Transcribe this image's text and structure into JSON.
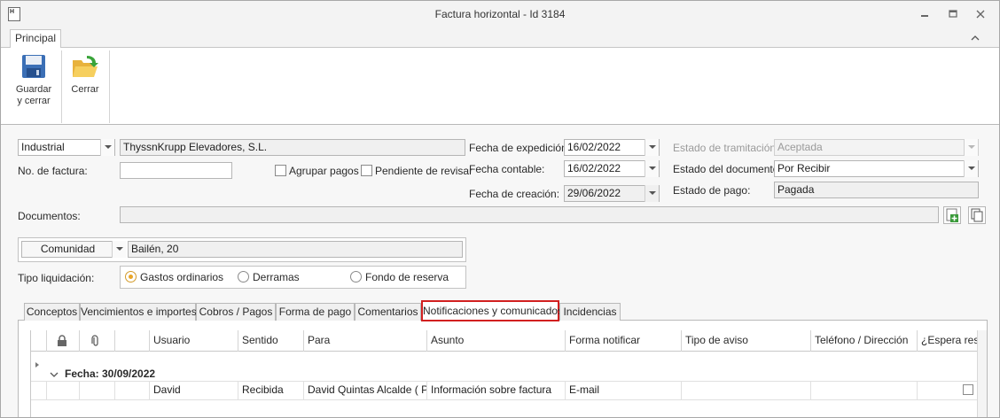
{
  "window": {
    "title": "Factura horizontal - Id 3184",
    "app_icon_text": "H"
  },
  "ribbon": {
    "tab_principal": "Principal",
    "save_label_1": "Guardar",
    "save_label_2": "y cerrar",
    "close_label": "Cerrar"
  },
  "form": {
    "tipo_value": "Industrial",
    "proveedor_value": "ThyssnKrupp Elevadores, S.L.",
    "factura_label": "No. de factura:",
    "factura_value": "",
    "agrupar_label": "Agrupar pagos",
    "pendiente_label": "Pendiente de revisar",
    "fecha_expedicion_label": "Fecha de expedición:",
    "fecha_expedicion_value": "16/02/2022",
    "fecha_contable_label": "Fecha contable:",
    "fecha_contable_value": "16/02/2022",
    "fecha_creacion_label": "Fecha de creación:",
    "fecha_creacion_value": "29/06/2022",
    "estado_tramitacion_label": "Estado de tramitación:",
    "estado_tramitacion_value": "Aceptada",
    "estado_documento_label": "Estado del documento:",
    "estado_documento_value": "Por Recibir",
    "estado_pago_label": "Estado de pago:",
    "estado_pago_value": "Pagada",
    "documentos_label": "Documentos:",
    "comunidad_type": "Comunidad",
    "comunidad_value": "Bailén, 20",
    "tipo_liquidacion_label": "Tipo liquidación:",
    "radio_gastos": "Gastos ordinarios",
    "radio_derramas": "Derramas",
    "radio_fondo": "Fondo de reserva"
  },
  "tabs": {
    "t1": "Conceptos",
    "t2": "Vencimientos e importes",
    "t3": "Cobros / Pagos",
    "t4": "Forma de pago",
    "t5": "Comentarios",
    "t6": "Notificaciones y comunicados",
    "t7": "Incidencias"
  },
  "grid": {
    "columns": {
      "usuario": "Usuario",
      "sentido": "Sentido",
      "para": "Para",
      "asunto": "Asunto",
      "forma": "Forma notificar",
      "tipo": "Tipo de aviso",
      "telefono": "Teléfono / Dirección",
      "espera": "¿Espera resp"
    },
    "group_label": "Fecha: 30/09/2022",
    "row": {
      "usuario": "David",
      "sentido": "Recibida",
      "para": "David Quintas Alcalde ( P…",
      "asunto": "Información sobre factura",
      "forma": "E-mail",
      "tipo": "",
      "telefono": ""
    }
  }
}
